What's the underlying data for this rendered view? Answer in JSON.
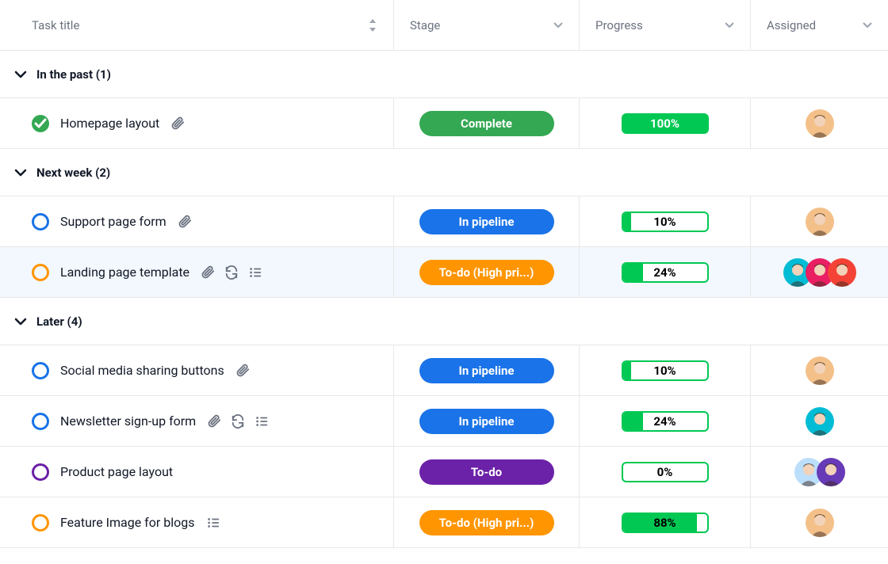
{
  "columns": {
    "title": "Task title",
    "stage": "Stage",
    "progress": "Progress",
    "assigned": "Assigned"
  },
  "groups": [
    {
      "label": "In the past (1)",
      "tasks": [
        {
          "name": "Homepage layout",
          "status": "complete",
          "icons": [
            "attachment"
          ],
          "stage": {
            "label": "Complete",
            "color": "green"
          },
          "progress": {
            "pct": 100,
            "label": "100%"
          },
          "assignees": [
            {
              "bg": "#f4c089",
              "img": "woman-glasses"
            }
          ],
          "selected": false
        }
      ]
    },
    {
      "label": "Next week (2)",
      "tasks": [
        {
          "name": "Support page form",
          "status": "blue",
          "icons": [
            "attachment"
          ],
          "stage": {
            "label": "In pipeline",
            "color": "blue"
          },
          "progress": {
            "pct": 10,
            "label": "10%"
          },
          "assignees": [
            {
              "bg": "#f4c089",
              "img": "woman-glasses"
            }
          ],
          "selected": false
        },
        {
          "name": "Landing page template",
          "status": "orange",
          "icons": [
            "attachment",
            "recurring",
            "subtasks"
          ],
          "stage": {
            "label": "To-do (High pri...)",
            "color": "orange"
          },
          "progress": {
            "pct": 24,
            "label": "24%"
          },
          "assignees": [
            {
              "bg": "#00bcd4",
              "img": "woman-short"
            },
            {
              "bg": "#e91e63",
              "img": "woman-dark"
            },
            {
              "bg": "#f44336",
              "img": "man-beard"
            }
          ],
          "selected": true
        }
      ]
    },
    {
      "label": "Later (4)",
      "tasks": [
        {
          "name": "Social media sharing buttons",
          "status": "blue",
          "icons": [
            "attachment"
          ],
          "stage": {
            "label": "In pipeline",
            "color": "blue"
          },
          "progress": {
            "pct": 10,
            "label": "10%"
          },
          "assignees": [
            {
              "bg": "#f4c089",
              "img": "woman-glasses"
            }
          ],
          "selected": false
        },
        {
          "name": "Newsletter sign-up form",
          "status": "blue",
          "icons": [
            "attachment",
            "recurring",
            "subtasks"
          ],
          "stage": {
            "label": "In pipeline",
            "color": "blue"
          },
          "progress": {
            "pct": 24,
            "label": "24%"
          },
          "assignees": [
            {
              "bg": "#00bcd4",
              "img": "woman-short"
            }
          ],
          "selected": false
        },
        {
          "name": "Product page layout",
          "status": "purple",
          "icons": [],
          "stage": {
            "label": "To-do",
            "color": "purple"
          },
          "progress": {
            "pct": 0,
            "label": "0%"
          },
          "assignees": [
            {
              "bg": "#bbdefb",
              "img": "man-light"
            },
            {
              "bg": "#673ab7",
              "img": "man-dark"
            }
          ],
          "selected": false
        },
        {
          "name": "Feature Image for blogs",
          "status": "orange",
          "icons": [
            "subtasks"
          ],
          "stage": {
            "label": "To-do (High pri...)",
            "color": "orange"
          },
          "progress": {
            "pct": 88,
            "label": "88%"
          },
          "assignees": [
            {
              "bg": "#f4c089",
              "img": "woman-glasses"
            }
          ],
          "selected": false
        }
      ]
    }
  ]
}
